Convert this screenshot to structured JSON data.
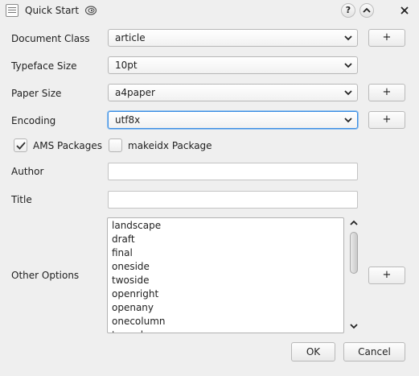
{
  "window": {
    "title": "Quick Start",
    "help_label": "?",
    "minimize_glyph": "⌃",
    "close_glyph": "✕"
  },
  "form": {
    "document_class": {
      "label": "Document Class",
      "value": "article",
      "add_label": "+"
    },
    "typeface_size": {
      "label": "Typeface Size",
      "value": "10pt"
    },
    "paper_size": {
      "label": "Paper Size",
      "value": "a4paper",
      "add_label": "+"
    },
    "encoding": {
      "label": "Encoding",
      "value": "utf8x",
      "add_label": "+"
    },
    "ams_packages": {
      "label": "AMS Packages",
      "checked": true
    },
    "makeidx_package": {
      "label": "makeidx Package",
      "checked": false
    },
    "author": {
      "label": "Author",
      "value": ""
    },
    "title": {
      "label": "Title",
      "value": ""
    },
    "other_options": {
      "label": "Other Options",
      "add_label": "+",
      "items": [
        "landscape",
        "draft",
        "final",
        "oneside",
        "twoside",
        "openright",
        "openany",
        "onecolumn",
        "twocolumn"
      ]
    }
  },
  "buttons": {
    "ok": "OK",
    "cancel": "Cancel"
  },
  "colors": {
    "background": "#efefef",
    "focus": "#3d8ee3",
    "list_background": "#ffffff"
  }
}
